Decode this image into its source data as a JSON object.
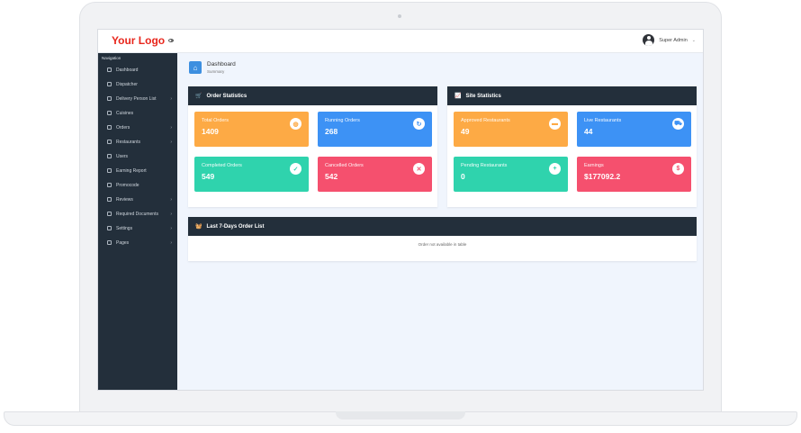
{
  "app": {
    "logo": "Your Logo",
    "user_name": "Super Admin"
  },
  "sidebar": {
    "title": "Navigation",
    "items": [
      {
        "label": "Dashboard",
        "has_submenu": false
      },
      {
        "label": "Dispatcher",
        "has_submenu": false
      },
      {
        "label": "Delivery Person List",
        "has_submenu": true
      },
      {
        "label": "Cuisines",
        "has_submenu": false
      },
      {
        "label": "Orders",
        "has_submenu": true
      },
      {
        "label": "Restaurants",
        "has_submenu": true
      },
      {
        "label": "Users",
        "has_submenu": false
      },
      {
        "label": "Earning Report",
        "has_submenu": false
      },
      {
        "label": "Promocode",
        "has_submenu": false
      },
      {
        "label": "Reviews",
        "has_submenu": true
      },
      {
        "label": "Required Documents",
        "has_submenu": true
      },
      {
        "label": "Settings",
        "has_submenu": true
      },
      {
        "label": "Pages",
        "has_submenu": true
      }
    ]
  },
  "page_header": {
    "title": "Dashboard",
    "subtitle": "Summary"
  },
  "order_statistics": {
    "title": "Order Statistics",
    "cards": [
      {
        "label": "Total Orders",
        "value": "1409",
        "color": "#fdaa45",
        "icon": "basket-icon"
      },
      {
        "label": "Running Orders",
        "value": "268",
        "color": "#3d92f5",
        "icon": "refresh-icon"
      },
      {
        "label": "Completed Orders",
        "value": "549",
        "color": "#2fd3ad",
        "icon": "check-icon"
      },
      {
        "label": "Cancelled Orders",
        "value": "542",
        "color": "#f5506e",
        "icon": "close-icon"
      }
    ]
  },
  "site_statistics": {
    "title": "Site Statistics",
    "cards": [
      {
        "label": "Approved Restaurants",
        "value": "49",
        "color": "#fdaa45",
        "icon": "store-icon"
      },
      {
        "label": "Live Restaurants",
        "value": "44",
        "color": "#3d92f5",
        "icon": "scooter-icon"
      },
      {
        "label": "Pending Restaurants",
        "value": "0",
        "color": "#2fd3ad",
        "icon": "user-plus-icon"
      },
      {
        "label": "Earnings",
        "value": "$177092.2",
        "color": "#f5506e",
        "icon": "money-icon"
      }
    ]
  },
  "order_list": {
    "title": "Last 7-Days Order List",
    "empty_message": "Order not available in table"
  }
}
